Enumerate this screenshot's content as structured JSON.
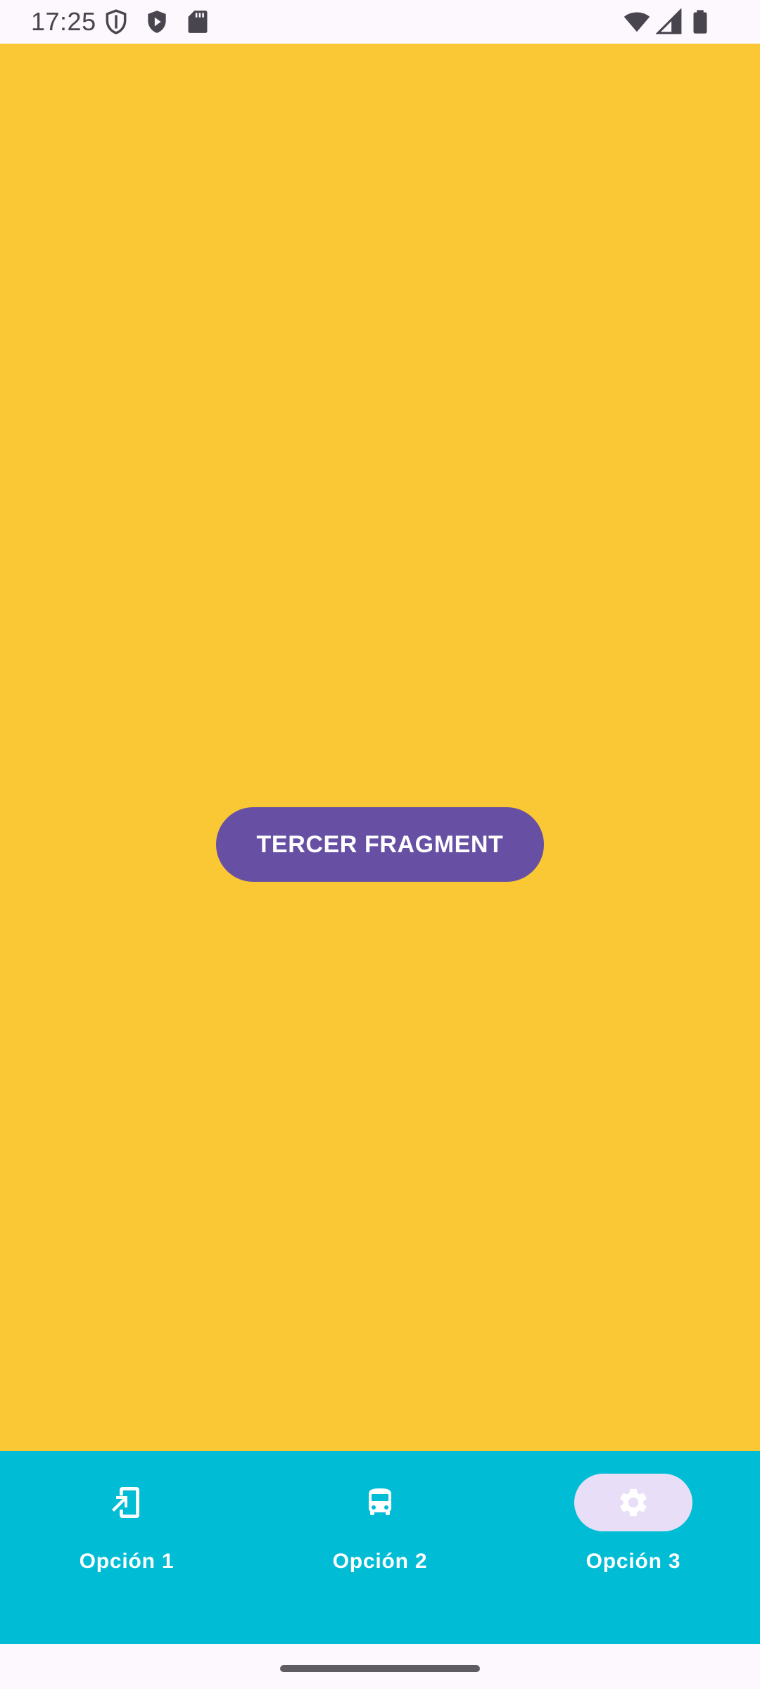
{
  "status_bar": {
    "time": "17:25",
    "left_icons": [
      "shield-outline-icon",
      "play-shield-icon",
      "sd-card-icon"
    ],
    "right_icons": [
      "wifi-icon",
      "cell-signal-icon",
      "battery-icon"
    ]
  },
  "main": {
    "background_color": "#F9C834",
    "button_label": "TERCER FRAGMENT",
    "button_color": "#6750A4"
  },
  "bottom_nav": {
    "background_color": "#00BCD4",
    "selected_index": 2,
    "items": [
      {
        "label": "Opción 1",
        "icon": "phone-forward-icon"
      },
      {
        "label": "Opción 2",
        "icon": "bus-icon"
      },
      {
        "label": "Opción 3",
        "icon": "gear-icon"
      }
    ]
  }
}
